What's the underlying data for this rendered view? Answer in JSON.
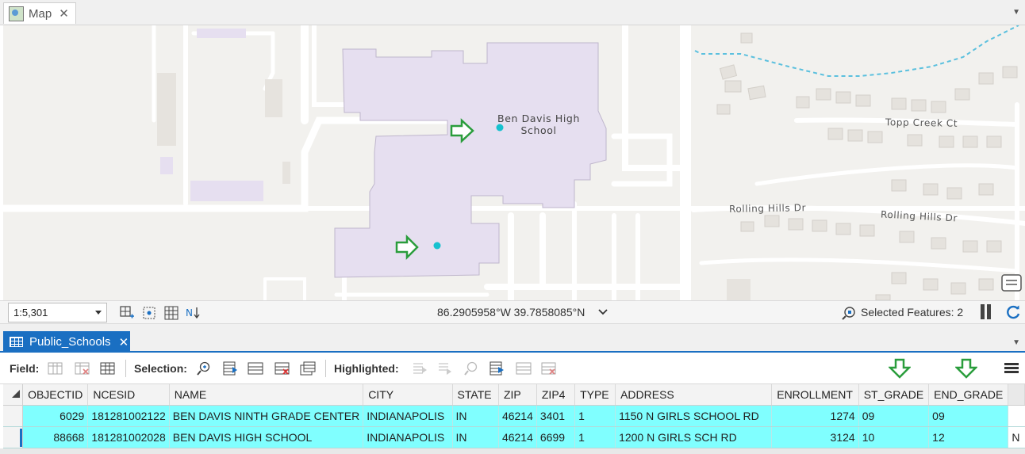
{
  "map_tab": {
    "title": "Map",
    "close": "✕"
  },
  "map": {
    "labels": {
      "school_line1": "Ben Davis High",
      "school_line2": "School",
      "topp_creek": "Topp Creek Ct",
      "rolling_hills_1": "Rolling Hills Dr",
      "rolling_hills_2": "Rolling Hills Dr"
    },
    "colors": {
      "building": "#e6dff0",
      "road": "#ffffff",
      "background": "#f2f1ee",
      "water": "#5bc0de",
      "point": "#17c1cf",
      "arrow": "#2a9d3c"
    }
  },
  "status_bar": {
    "scale": "1:5,301",
    "coordinates": "86.2905958°W 39.7858085°N",
    "selected_features": "Selected Features: 2"
  },
  "table_tab": {
    "title": "Public_Schools",
    "close": "✕"
  },
  "toolbar": {
    "field_label": "Field:",
    "selection_label": "Selection:",
    "highlighted_label": "Highlighted:"
  },
  "table": {
    "columns": [
      "OBJECTID",
      "NCESID",
      "NAME",
      "CITY",
      "STATE",
      "ZIP",
      "ZIP4",
      "TYPE",
      "ADDRESS",
      "ENROLLMENT",
      "ST_GRADE",
      "END_GRADE"
    ],
    "rows": [
      [
        "6029",
        "181281002122",
        "BEN DAVIS NINTH GRADE CENTER",
        "INDIANAPOLIS",
        "IN",
        "46214",
        "3401",
        "1",
        "1150 N GIRLS SCHOOL RD",
        "1274",
        "09",
        "09"
      ],
      [
        "88668",
        "181281002028",
        "BEN DAVIS HIGH SCHOOL",
        "INDIANAPOLIS",
        "IN",
        "46214",
        "6699",
        "1",
        "1200 N GIRLS SCH RD",
        "3124",
        "10",
        "12"
      ]
    ],
    "trailing_cell": "N"
  }
}
